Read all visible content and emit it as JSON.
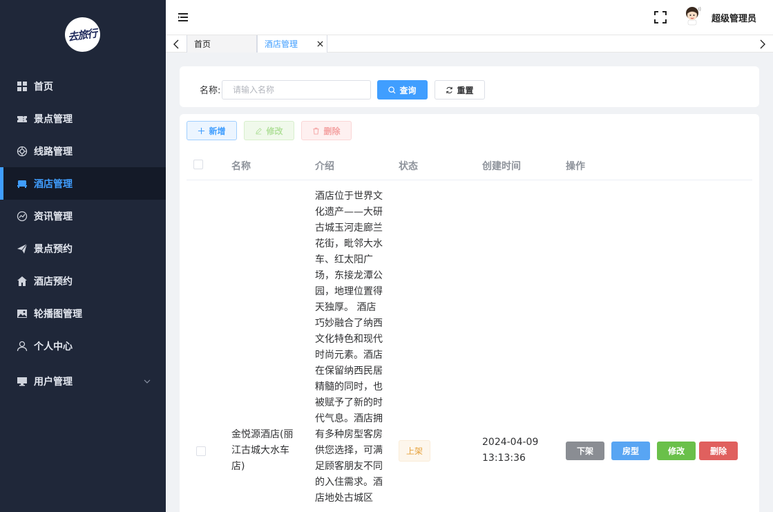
{
  "logo": {
    "text": "去旅行"
  },
  "sidebar": {
    "items": [
      {
        "label": "首页",
        "icon": "grid-icon"
      },
      {
        "label": "景点管理",
        "icon": "ticket-icon"
      },
      {
        "label": "线路管理",
        "icon": "route-icon"
      },
      {
        "label": "酒店管理",
        "icon": "bed-icon",
        "active": true
      },
      {
        "label": "资讯管理",
        "icon": "news-icon"
      },
      {
        "label": "景点预约",
        "icon": "paper-plane-icon"
      },
      {
        "label": "酒店预约",
        "icon": "house-icon"
      },
      {
        "label": "轮播图管理",
        "icon": "image-icon"
      },
      {
        "label": "个人中心",
        "icon": "user-icon"
      },
      {
        "label": "用户管理",
        "icon": "monitor-icon",
        "expandable": true
      }
    ]
  },
  "header": {
    "username": "超级管理员"
  },
  "tags": [
    {
      "label": "首页"
    },
    {
      "label": "酒店管理",
      "active": true
    }
  ],
  "search": {
    "label": "名称:",
    "placeholder": "请输入名称",
    "value": "",
    "query_label": "查询",
    "reset_label": "重置"
  },
  "toolbar": {
    "add_label": "新增",
    "edit_label": "修改",
    "delete_label": "删除"
  },
  "table": {
    "columns": [
      "名称",
      "介绍",
      "状态",
      "创建时间",
      "操作"
    ],
    "rows": [
      {
        "name": "金悦源酒店(丽江古城大水车店)",
        "intro": "酒店位于世界文化遗产——大研古城玉河走廊兰花街，毗邻大水车、红太阳广场，东接龙潭公园，地理位置得天独厚。 酒店巧妙融合了纳西文化特色和现代时尚元素。酒店在保留纳西民居精髓的同时，也被赋予了新的时代气息。酒店拥有多种房型客房供您选择，可满足顾客朋友不同的入住需求。酒店地处古城区",
        "status": "上架",
        "created": "2024-04-09 13:13:36",
        "actions": [
          "下架",
          "房型",
          "修改",
          "删除"
        ]
      }
    ]
  },
  "colors": {
    "sidebar_bg": "#1f2739",
    "accent": "#409eff",
    "success": "#6ac04a",
    "danger": "#e0605e",
    "warning": "#e6a23c"
  }
}
